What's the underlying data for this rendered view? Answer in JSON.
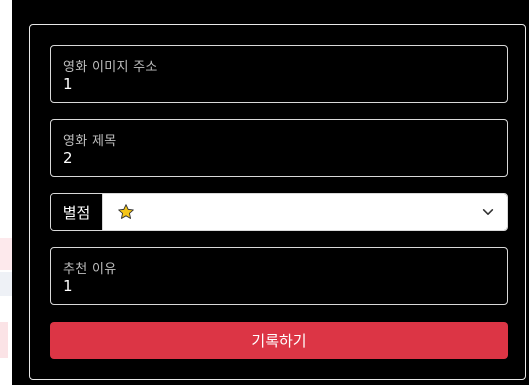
{
  "form": {
    "image_url_field": {
      "label": "영화 이미지 주소",
      "value": "1"
    },
    "title_field": {
      "label": "영화 제목",
      "value": "2"
    },
    "rating": {
      "label": "별점",
      "selected_value": "⭐",
      "icon": "star-icon",
      "star_color": "#f5c518"
    },
    "reason_field": {
      "label": "추천 이유",
      "value": "1"
    },
    "submit_label": "기록하기"
  },
  "colors": {
    "accent": "#dc3545",
    "background": "#000000",
    "border": "#d8d8d8"
  }
}
